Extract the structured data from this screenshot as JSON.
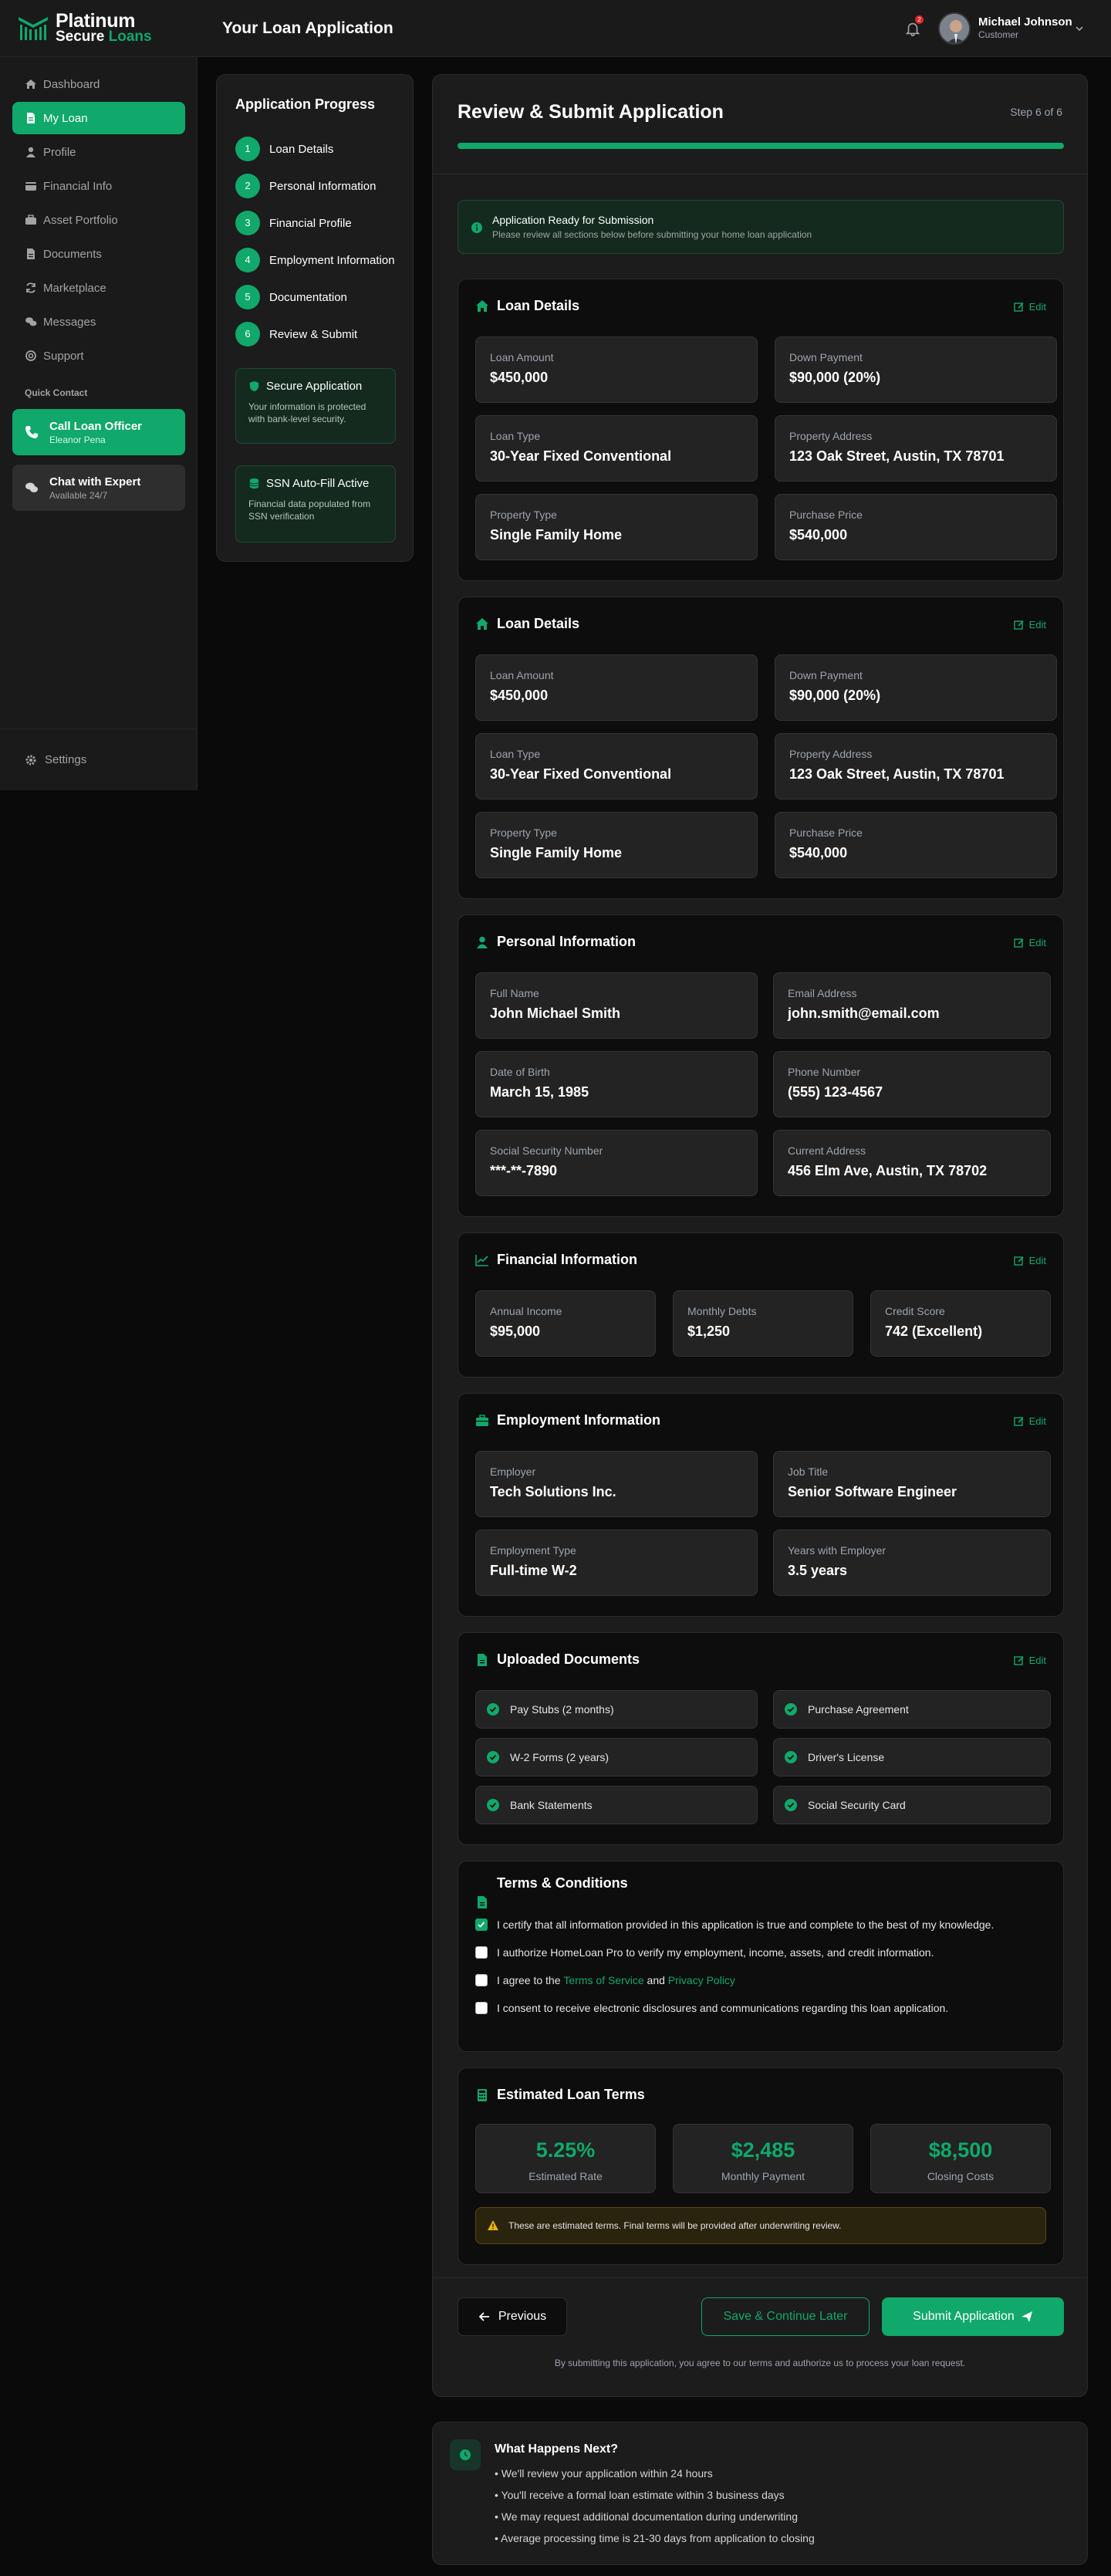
{
  "brand": {
    "line1": "Platinum",
    "line2a": "Secure",
    "line2b": "Loans"
  },
  "header": {
    "title": "Your Loan Application",
    "notifications": "2",
    "user_name": "Michael Johnson",
    "user_role": "Customer"
  },
  "sidebar": {
    "items": [
      {
        "label": "Dashboard",
        "icon": "home-icon"
      },
      {
        "label": "My Loan",
        "icon": "file-icon"
      },
      {
        "label": "Profile",
        "icon": "user-icon"
      },
      {
        "label": "Financial Info",
        "icon": "wallet-icon"
      },
      {
        "label": "Asset Portfolio",
        "icon": "briefcase-icon"
      },
      {
        "label": "Documents",
        "icon": "document-icon"
      },
      {
        "label": "Marketplace",
        "icon": "refresh-icon"
      },
      {
        "label": "Messages",
        "icon": "chat-icon"
      },
      {
        "label": "Support",
        "icon": "support-icon"
      }
    ],
    "quick_contact_label": "Quick Contact",
    "call": {
      "title": "Call Loan Officer",
      "subtitle": "Eleanor Pena"
    },
    "chat": {
      "title": "Chat with Expert",
      "subtitle": "Available 24/7"
    },
    "settings": "Settings"
  },
  "progress": {
    "title": "Application Progress",
    "steps": [
      {
        "num": "1",
        "label": "Loan Details"
      },
      {
        "num": "2",
        "label": "Personal Information"
      },
      {
        "num": "3",
        "label": "Financial Profile"
      },
      {
        "num": "4",
        "label": "Employment Information"
      },
      {
        "num": "5",
        "label": "Documentation"
      },
      {
        "num": "6",
        "label": "Review & Submit"
      }
    ],
    "secure": {
      "title": "Secure Application",
      "text": "Your information is protected with bank-level security."
    },
    "ssn": {
      "title": "SSN Auto-Fill Active",
      "text": "Financial data populated from SSN verification"
    }
  },
  "main": {
    "title": "Review & Submit Application",
    "step_of": "Step 6 of 6",
    "progress_fraction": 1.0,
    "ready": {
      "title": "Application Ready for Submission",
      "text": "Please review all sections below before submitting your home loan application"
    },
    "edit_label": "Edit",
    "loan": {
      "title": "Loan Details",
      "fields": [
        {
          "label": "Loan Amount",
          "value": "$450,000"
        },
        {
          "label": "Down Payment",
          "value": "$90,000 (20%)"
        },
        {
          "label": "Loan Type",
          "value": "30-Year Fixed Conventional"
        },
        {
          "label": "Property Address",
          "value": "123 Oak Street, Austin, TX 78701"
        },
        {
          "label": "Property Type",
          "value": "Single Family Home"
        },
        {
          "label": "Purchase Price",
          "value": "$540,000"
        }
      ]
    },
    "personal": {
      "title": "Personal Information",
      "fields": [
        {
          "label": "Full Name",
          "value": "John Michael Smith"
        },
        {
          "label": "Email Address",
          "value": "john.smith@email.com"
        },
        {
          "label": "Date of Birth",
          "value": "March 15, 1985"
        },
        {
          "label": "Phone Number",
          "value": "(555) 123-4567"
        },
        {
          "label": "Social Security Number",
          "value": "***-**-7890"
        },
        {
          "label": "Current Address",
          "value": "456 Elm Ave, Austin, TX 78702"
        }
      ]
    },
    "financial": {
      "title": "Financial Information",
      "fields": [
        {
          "label": "Annual Income",
          "value": "$95,000"
        },
        {
          "label": "Monthly Debts",
          "value": "$1,250"
        },
        {
          "label": "Credit Score",
          "value": "742 (Excellent)"
        }
      ]
    },
    "employment": {
      "title": "Employment Information",
      "fields": [
        {
          "label": "Employer",
          "value": "Tech Solutions Inc."
        },
        {
          "label": "Job Title",
          "value": "Senior Software Engineer"
        },
        {
          "label": "Employment Type",
          "value": "Full-time W-2"
        },
        {
          "label": "Years with Employer",
          "value": "3.5 years"
        }
      ]
    },
    "documents": {
      "title": "Uploaded Documents",
      "items": [
        "Pay Stubs (2 months)",
        "Purchase Agreement",
        "W-2 Forms (2 years)",
        "Driver's License",
        "Bank Statements",
        "Social Security Card"
      ]
    },
    "terms": {
      "title": "Terms & Conditions",
      "t1": "I certify that all information provided in this application is true and complete to the best of my knowledge.",
      "t2": "I authorize HomeLoan Pro to verify my employment, income, assets, and credit information.",
      "t3_pre": "I agree to the",
      "t3_link1": "Terms of Service",
      "t3_and": "and",
      "t3_link2": "Privacy Policy",
      "t4": "I consent to receive electronic disclosures and communications regarding this loan application."
    },
    "estimate": {
      "title": "Estimated Loan Terms",
      "items": [
        {
          "value": "5.25%",
          "label": "Estimated Rate"
        },
        {
          "value": "$2,485",
          "label": "Monthly Payment"
        },
        {
          "value": "$8,500",
          "label": "Closing Costs"
        }
      ],
      "warning": "These are estimated terms. Final terms will be provided after underwriting review."
    },
    "actions": {
      "previous": "Previous",
      "save": "Save & Continue Later",
      "submit": "Submit Application",
      "disclaimer": "By submitting this application, you agree to our terms and authorize us to process your loan request."
    }
  },
  "next": {
    "title": "What Happens Next?",
    "items": [
      "• We'll review your application within 24 hours",
      "• You'll receive a formal loan estimate within 3 business days",
      "• We may request additional documentation during underwriting",
      "• Average processing time is 21-30 days from application to closing"
    ]
  },
  "colors": {
    "accent": "#10a86b",
    "background": "#0a0a0a",
    "panel": "#1c1c1c"
  }
}
